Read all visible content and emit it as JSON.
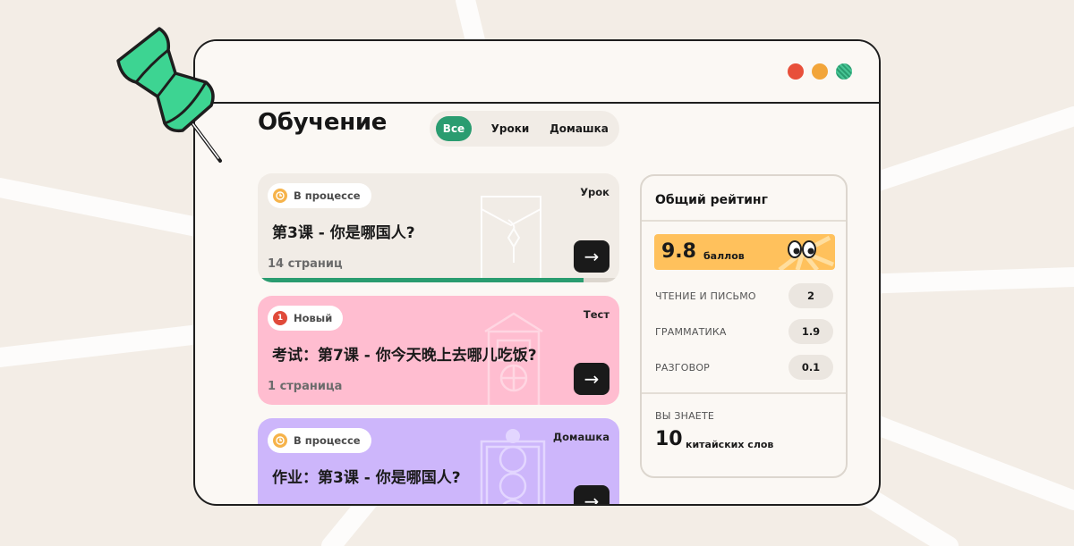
{
  "page": {
    "title": "Обучение",
    "filters": [
      {
        "label": "Все",
        "active": true
      },
      {
        "label": "Уроки",
        "active": false
      },
      {
        "label": "Домашка",
        "active": false
      }
    ]
  },
  "window": {
    "controls": [
      "close",
      "minimize",
      "maximize"
    ],
    "control_colors": [
      "#e8503a",
      "#f2a53a",
      "#2a9c70"
    ]
  },
  "cards": [
    {
      "status": "В процессе",
      "status_icon": "clock-icon",
      "type": "Урок",
      "title": "第3课 - 你是哪国人?",
      "pages": "14 страниц",
      "progress": 0.9,
      "color": "#f1ece6"
    },
    {
      "status": "Новый",
      "status_number": "1",
      "type": "Тест",
      "title": "考试：第7课 - 你今天晚上去哪儿吃饭?",
      "pages": "1 страница",
      "color": "#ffbdd0"
    },
    {
      "status": "В процессе",
      "status_icon": "clock-icon",
      "type": "Домашка",
      "title": "作业：第3课 - 你是哪国人?",
      "color": "#cdb6fb"
    }
  ],
  "rating": {
    "title": "Общий рейтинг",
    "score": "9.8",
    "score_unit": "баллов",
    "metrics": [
      {
        "label": "ЧТЕНИЕ И ПИСЬМО",
        "value": "2"
      },
      {
        "label": "ГРАММАТИКА",
        "value": "1.9"
      },
      {
        "label": "РАЗГОВОР",
        "value": "0.1"
      }
    ],
    "known_label": "ВЫ ЗНАЕТЕ",
    "known_count": "10",
    "known_unit": "китайских слов"
  },
  "colors": {
    "accent": "#2a9c70",
    "score_bg": "#ffc15c",
    "background": "#f3ede6",
    "pin": "#3dd492"
  },
  "icons": {
    "arrow": "→",
    "pin": "pushpin-icon"
  }
}
